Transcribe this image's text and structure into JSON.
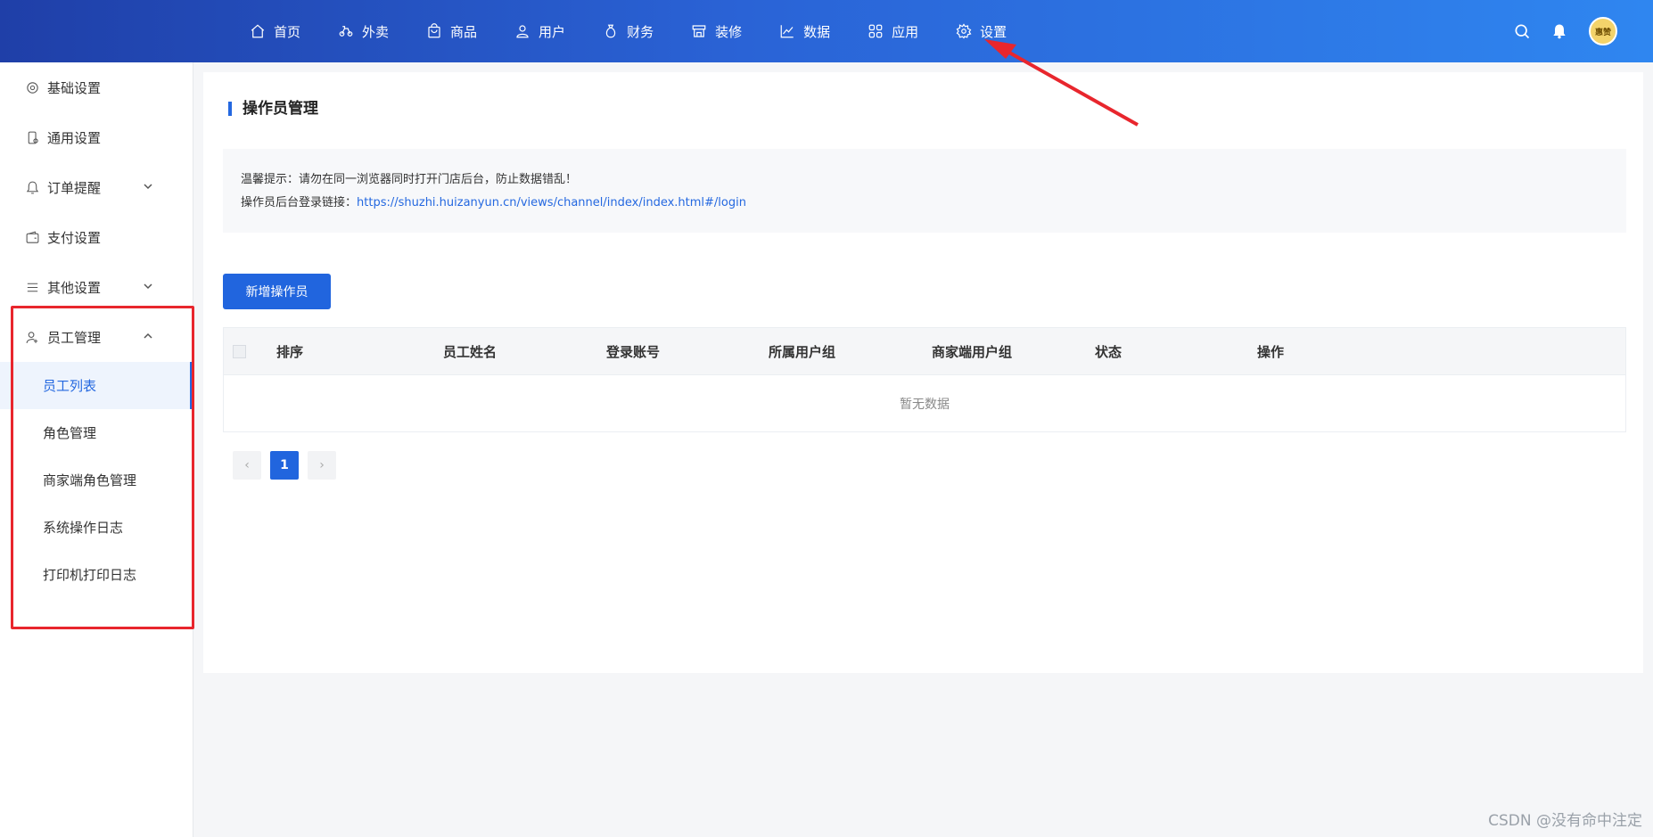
{
  "topnav": {
    "items": [
      {
        "label": "首页",
        "icon": "home-icon"
      },
      {
        "label": "外卖",
        "icon": "bike-icon"
      },
      {
        "label": "商品",
        "icon": "bag-icon"
      },
      {
        "label": "用户",
        "icon": "user-icon"
      },
      {
        "label": "财务",
        "icon": "money-bag-icon"
      },
      {
        "label": "装修",
        "icon": "shop-icon"
      },
      {
        "label": "数据",
        "icon": "chart-icon"
      },
      {
        "label": "应用",
        "icon": "apps-icon"
      },
      {
        "label": "设置",
        "icon": "gear-icon"
      }
    ],
    "avatar_text": "惠赞"
  },
  "sidebar": {
    "items": [
      {
        "label": "基础设置",
        "icon": "gear-icon"
      },
      {
        "label": "通用设置",
        "icon": "phone-icon"
      },
      {
        "label": "订单提醒",
        "icon": "bell-icon"
      },
      {
        "label": "支付设置",
        "icon": "wallet-icon"
      },
      {
        "label": "其他设置",
        "icon": "list-icon"
      },
      {
        "label": "员工管理",
        "icon": "user-settings-icon"
      }
    ],
    "sub_items": [
      "员工列表",
      "角色管理",
      "商家端角色管理",
      "系统操作日志",
      "打印机打印日志"
    ]
  },
  "main": {
    "title": "操作员管理",
    "tip_line1": "温馨提示：请勿在同一浏览器同时打开门店后台，防止数据错乱！",
    "tip_line2_prefix": "操作员后台登录链接：",
    "tip_link": "https://shuzhi.huizanyun.cn/views/channel/index/index.html#/login",
    "add_button": "新增操作员",
    "table": {
      "columns": [
        "排序",
        "员工姓名",
        "登录账号",
        "所属用户组",
        "商家端用户组",
        "状态",
        "操作"
      ],
      "empty_text": "暂无数据"
    },
    "pagination": {
      "current_page": "1",
      "prev": "‹",
      "next": "›"
    }
  },
  "watermark": "CSDN @没有命中注定",
  "colors": {
    "accent": "#2165de",
    "annotation": "#e8262d"
  }
}
